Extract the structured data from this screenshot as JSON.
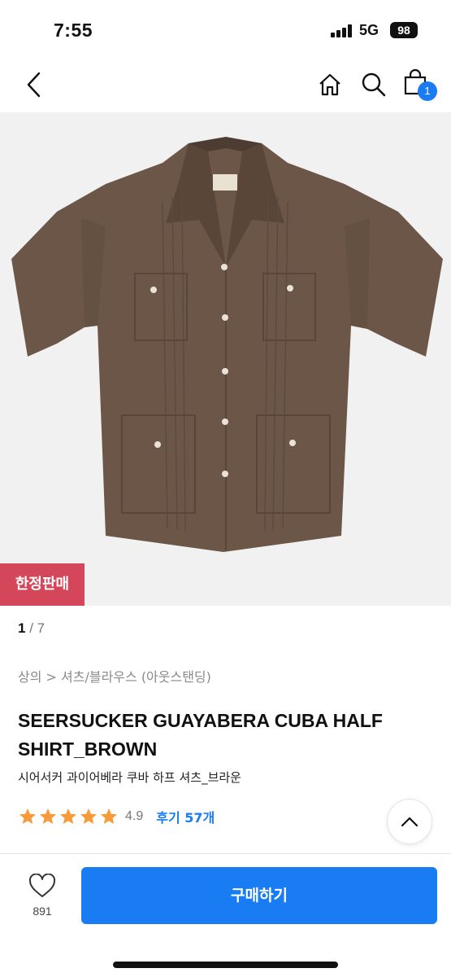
{
  "status_bar": {
    "time": "7:55",
    "network": "5G",
    "battery": "98"
  },
  "nav": {
    "back_icon": "chevron-left-icon",
    "home_icon": "home-icon",
    "search_icon": "search-icon",
    "cart_icon": "shopping-bag-icon",
    "cart_count": "1"
  },
  "product": {
    "badge": "한정판매",
    "image_index": "1",
    "image_total": "/ 7",
    "breadcrumb": "상의 > 셔츠/블라우스 (아웃스탠딩)",
    "title": "SEERSUCKER GUAYABERA CUBA HALF SHIRT_BROWN",
    "subtitle": "시어서커 과이어베라 쿠바 하프 셔츠_브라운",
    "rating": {
      "value": "4.9",
      "stars": 5,
      "review_label": "후기 57개"
    },
    "shirt_color": "#6b5647"
  },
  "actions": {
    "scroll_top_icon": "chevron-up-icon",
    "like_icon": "heart-icon",
    "like_count": "891",
    "buy_label": "구매하기"
  },
  "colors": {
    "accent": "#1a7cf3",
    "badge": "#d4475a",
    "star": "#f79b3a"
  }
}
